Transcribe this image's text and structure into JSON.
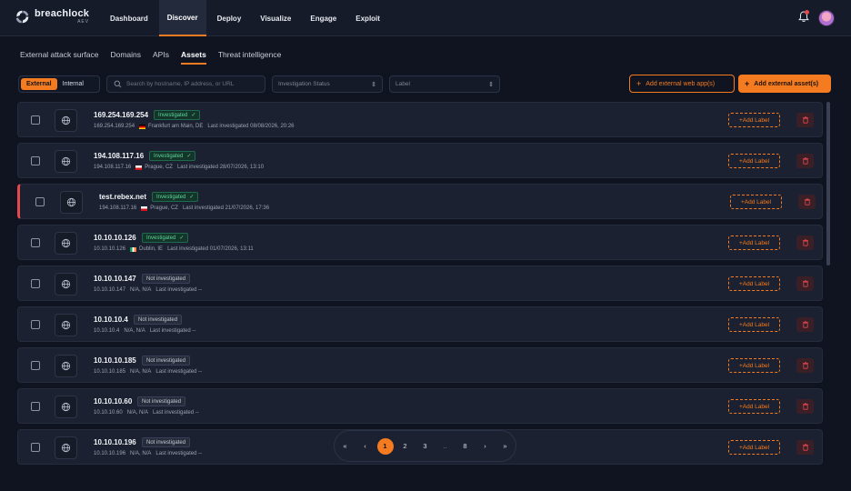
{
  "brand": {
    "name": "breachlock",
    "sub": "AEV",
    "accent": "#f47b20"
  },
  "nav": [
    "Dashboard",
    "Discover",
    "Deploy",
    "Visualize",
    "Engage",
    "Exploit"
  ],
  "nav_active": "Discover",
  "subtabs": [
    "External attack surface",
    "Domains",
    "APIs",
    "Assets",
    "Threat intelligence"
  ],
  "subtab_active": "Assets",
  "filters": {
    "scope_external": "External",
    "scope_internal": "Internal",
    "search_placeholder": "Search by hostname, IP address, or URL",
    "status_placeholder": "Investigation Status",
    "label_placeholder": "Label"
  },
  "actions": {
    "add_web_app": "Add external web app(s)",
    "add_asset": "Add external asset(s)"
  },
  "row_action_label": "Add Label",
  "last_prefix": "Last investigated",
  "assets": [
    {
      "name": "169.254.169.254",
      "status": "Investigated",
      "ip": "169.254.169.254",
      "location": "Frankfurt am Main, DE",
      "flag": "de",
      "last": "08/08/2026, 20:26"
    },
    {
      "name": "194.108.117.16",
      "status": "Investigated",
      "ip": "194.108.117.16",
      "location": "Prague, CZ",
      "flag": "cz",
      "last": "28/07/2026, 13:10"
    },
    {
      "name": "test.rebex.net",
      "status": "Investigated",
      "ip": "194.108.117.16",
      "location": "Prague, CZ",
      "flag": "cz",
      "last": "21/07/2026, 17:36",
      "flagged": true
    },
    {
      "name": "10.10.10.126",
      "status": "Investigated",
      "ip": "10.10.10.126",
      "location": "Dublin, IE",
      "flag": "ie",
      "last": "01/07/2026, 13:11"
    },
    {
      "name": "10.10.10.147",
      "status": "Not investigated",
      "ip": "10.10.10.147",
      "location": "N/A, N/A",
      "flag": "",
      "last": "--"
    },
    {
      "name": "10.10.10.4",
      "status": "Not investigated",
      "ip": "10.10.10.4",
      "location": "N/A, N/A",
      "flag": "",
      "last": "--"
    },
    {
      "name": "10.10.10.185",
      "status": "Not investigated",
      "ip": "10.10.10.185",
      "location": "N/A, N/A",
      "flag": "",
      "last": "--"
    },
    {
      "name": "10.10.10.60",
      "status": "Not investigated",
      "ip": "10.10.10.60",
      "location": "N/A, N/A",
      "flag": "",
      "last": "--"
    },
    {
      "name": "10.10.10.196",
      "status": "Not investigated",
      "ip": "10.10.10.196",
      "location": "N/A, N/A",
      "flag": "",
      "last": "--"
    }
  ],
  "pagination": {
    "first": "«",
    "prev": "‹",
    "pages": [
      "1",
      "2",
      "3",
      "..",
      "8"
    ],
    "current": "1",
    "next": "›",
    "last": "»"
  }
}
